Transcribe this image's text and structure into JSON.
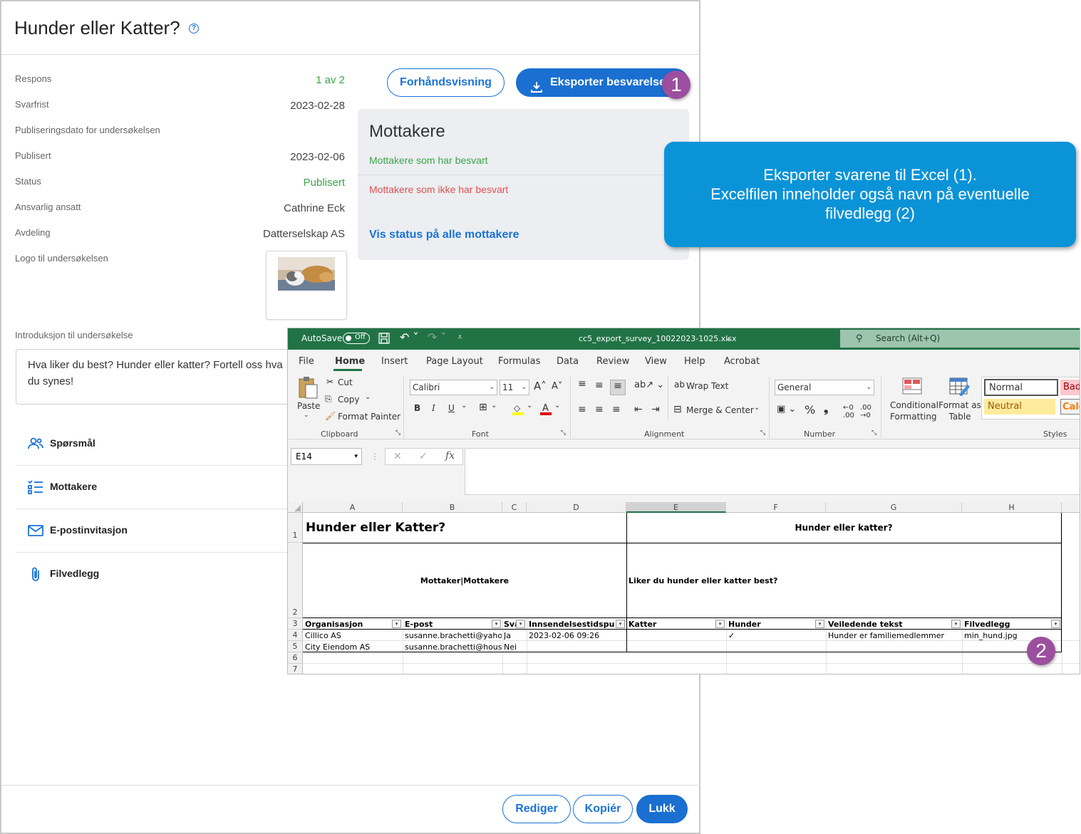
{
  "dialog": {
    "title": "Hunder eller Katter?",
    "meta": [
      {
        "label": "Respons",
        "value": "1 av 2"
      },
      {
        "label": "Svarfrist",
        "value": "2023-02-28"
      },
      {
        "label": "Publiseringsdato for undersøkelsen",
        "value": ""
      },
      {
        "label": "Publisert",
        "value": "2023-02-06"
      },
      {
        "label": "Status",
        "value": "Publisert"
      },
      {
        "label": "Ansvarlig ansatt",
        "value": "Cathrine Eck"
      },
      {
        "label": "Avdeling",
        "value": "Datterselskap AS"
      },
      {
        "label": "Logo til undersøkelsen",
        "value": ""
      }
    ],
    "intro_label": "Introduksjon til undersøkelse",
    "intro_text": "Hva liker du best? Hunder eller katter? Fortell oss hva du synes!",
    "nav": [
      {
        "label": "Spørsmål",
        "icon": "people-icon"
      },
      {
        "label": "Mottakere",
        "icon": "checklist-icon"
      },
      {
        "label": "E-postinvitasjon",
        "icon": "mail-icon"
      },
      {
        "label": "Filvedlegg",
        "icon": "paperclip-icon"
      }
    ],
    "preview_label": "Forhåndsvisning",
    "export_label": "Eksporter besvarelser",
    "recipients": {
      "title": "Mottakere",
      "answered": "Mottakere som har besvart",
      "not_answered": "Mottakere som ikke har besvart",
      "view_status": "Vis status på alle mottakere"
    },
    "footer": {
      "edit": "Rediger",
      "copy": "Kopiér",
      "close": "Lukk"
    }
  },
  "badges": {
    "one": "1",
    "two": "2"
  },
  "callout": {
    "line1": "Eksporter svarene til Excel (1).",
    "line2": "Excelfilen inneholder også navn på eventuelle filvedlegg (2)"
  },
  "excel": {
    "autosave": "AutoSave",
    "autosave_state": "Off",
    "filename": "cc5_export_survey_10022023-1025.xlsx",
    "search": "Search (Alt+Q)",
    "menu": [
      "File",
      "Home",
      "Insert",
      "Page Layout",
      "Formulas",
      "Data",
      "Review",
      "View",
      "Help",
      "Acrobat"
    ],
    "active_menu": "Home",
    "clipboard": {
      "paste": "Paste",
      "cut": "Cut",
      "copy": "Copy",
      "format_painter": "Format Painter",
      "group": "Clipboard"
    },
    "font": {
      "name": "Calibri",
      "size": "11",
      "group": "Font",
      "bold": "B",
      "italic": "I",
      "underline": "U"
    },
    "alignment": {
      "wrap": "Wrap Text",
      "merge": "Merge & Center",
      "group": "Alignment"
    },
    "number": {
      "format": "General",
      "group": "Number",
      "percent": "%"
    },
    "styles": {
      "conditional": "Conditional Formatting",
      "format_as_table": "Format as Table",
      "normal": "Normal",
      "bad": "Bad",
      "neutral": "Neutral",
      "calc": "Calc",
      "group": "Styles"
    },
    "namebox": "E14",
    "columns": [
      "A",
      "B",
      "C",
      "D",
      "E",
      "F",
      "G",
      "H"
    ],
    "rows": [
      "1",
      "2",
      "3",
      "4",
      "5",
      "6",
      "7"
    ],
    "cells": {
      "a1": "Hunder eller Katter?",
      "e1": "Hunder eller katter?",
      "a2": "Mottaker|Mottakere",
      "e2": "Liker du hunder eller katter best?",
      "headers": [
        "Organisasjon",
        "E-post",
        "Sva",
        "Innsendelsestidspunkt",
        "Katter",
        "Hunder",
        "Veiledende tekst",
        "Filvedlegg"
      ],
      "row4": [
        "Cillico AS",
        "susanne.brachetti@yaho",
        "Ja",
        "2023-02-06 09:26",
        "",
        "✓",
        "Hunder er  familiemedlemmer",
        "min_hund.jpg"
      ],
      "row5": [
        "City Eiendom AS",
        "susanne.brachetti@hous",
        "Nei",
        "",
        "",
        "",
        "",
        ""
      ]
    }
  }
}
